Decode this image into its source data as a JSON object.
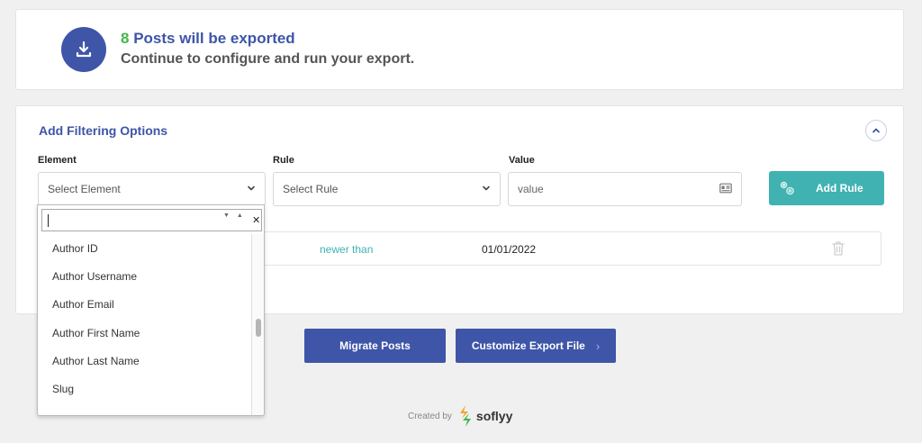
{
  "summary": {
    "count": "8",
    "headline_rest": "Posts will be exported",
    "subline": "Continue to configure and run your export."
  },
  "filter": {
    "title": "Add Filtering Options",
    "columns": {
      "element": "Element",
      "rule": "Rule",
      "value": "Value"
    },
    "element_select": "Select Element",
    "rule_select": "Select Rule",
    "value_placeholder": "value",
    "add_rule_label": "Add Rule",
    "existing_rule": {
      "operator": "newer than",
      "value": "01/01/2022"
    }
  },
  "dropdown": {
    "search_value": "",
    "items": [
      "Author ID",
      "Author Username",
      "Author Email",
      "Author First Name",
      "Author Last Name",
      "Slug"
    ]
  },
  "actions": {
    "migrate_label": "Migrate Posts",
    "customize_label": "Customize Export File"
  },
  "footer": {
    "created_by": "Created by",
    "brand": "soflyy"
  },
  "colors": {
    "primary": "#3e55a8",
    "accent_teal": "#40b2b2",
    "count_green": "#46b450",
    "background": "#f0f0f1"
  },
  "icons": {
    "export": "download-tray-icon",
    "collapse": "chevron-up-icon",
    "select": "chevron-down-icon",
    "value_field": "id-card-icon",
    "add_rule": "gears-icon",
    "delete_rule": "trash-icon",
    "next": "chevron-right-icon",
    "brand_logo": "soflyy-logo-icon"
  }
}
